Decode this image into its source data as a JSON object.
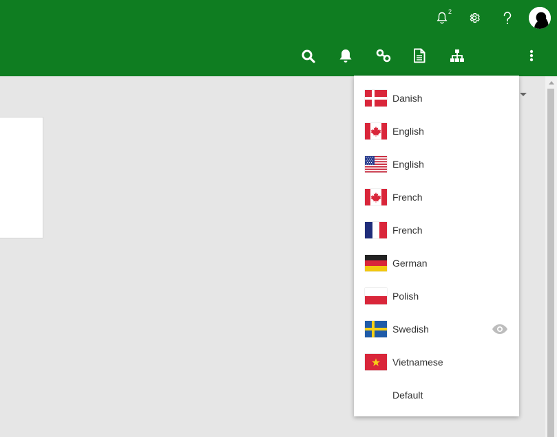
{
  "topbar": {
    "notification_count": "2",
    "icons": [
      "notification-bell-icon",
      "gear-icon",
      "help-icon",
      "avatar"
    ]
  },
  "toolbar": {
    "icons": [
      "search-icon",
      "bell-icon",
      "link-icon",
      "document-icon",
      "sitemap-icon",
      "language-flag-se",
      "more-vertical-icon"
    ]
  },
  "language_menu": {
    "items": [
      {
        "label": "Danish",
        "flag": "dk"
      },
      {
        "label": "English",
        "flag": "ca"
      },
      {
        "label": "English",
        "flag": "us"
      },
      {
        "label": "French",
        "flag": "ca"
      },
      {
        "label": "French",
        "flag": "fr"
      },
      {
        "label": "German",
        "flag": "de"
      },
      {
        "label": "Polish",
        "flag": "pl"
      },
      {
        "label": "Swedish",
        "flag": "se",
        "selected": true
      },
      {
        "label": "Vietnamese",
        "flag": "vn"
      },
      {
        "label": "Default",
        "flag": ""
      }
    ]
  },
  "colors": {
    "header_green": "#0f7d21",
    "background": "#e6e6e6",
    "menu_text": "#333333"
  }
}
